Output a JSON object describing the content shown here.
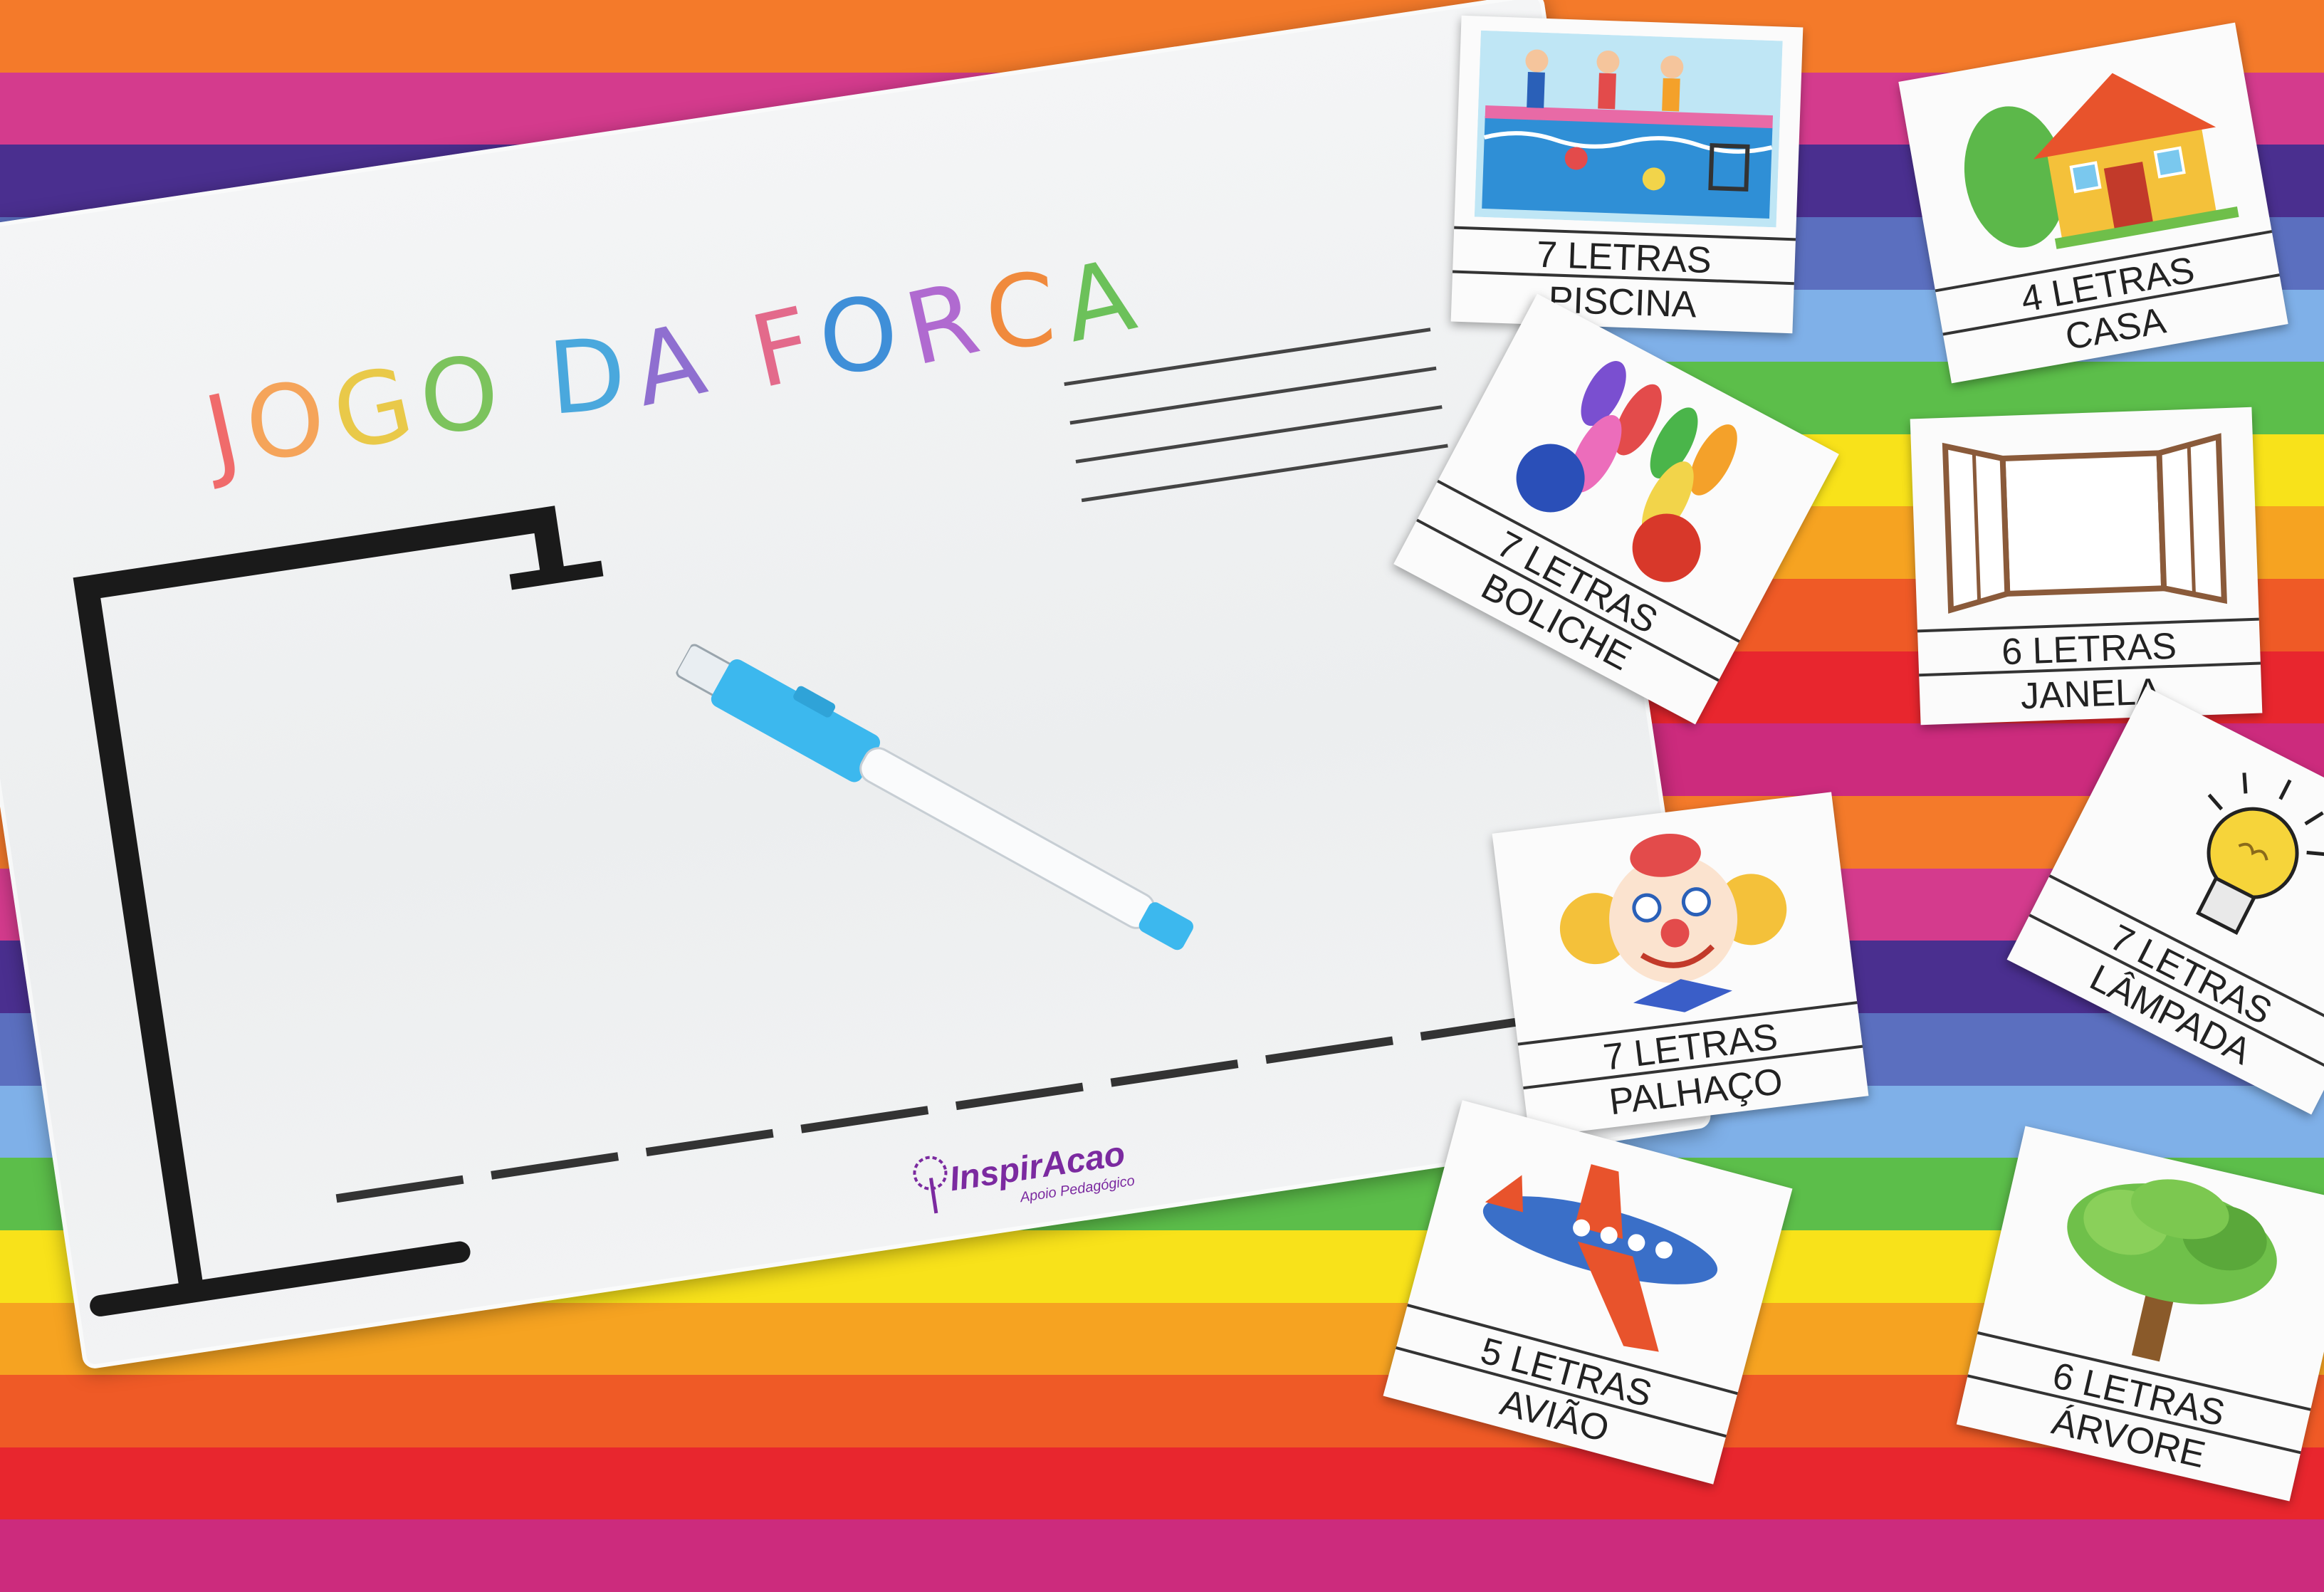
{
  "board": {
    "title_letters": [
      {
        "ch": "J",
        "color": "#f06b6b"
      },
      {
        "ch": "O",
        "color": "#f5a45a"
      },
      {
        "ch": "G",
        "color": "#e9c949"
      },
      {
        "ch": "O",
        "color": "#7cc35d"
      },
      {
        "ch": " ",
        "color": "#000000"
      },
      {
        "ch": "D",
        "color": "#4aa8dd"
      },
      {
        "ch": "A",
        "color": "#8f6fd0"
      },
      {
        "ch": " ",
        "color": "#000000"
      },
      {
        "ch": "F",
        "color": "#e36a8b"
      },
      {
        "ch": "O",
        "color": "#3f8fd8"
      },
      {
        "ch": "R",
        "color": "#b06ad0"
      },
      {
        "ch": "C",
        "color": "#f08a3d"
      },
      {
        "ch": "A",
        "color": "#6cc15a"
      }
    ],
    "logo_text": "InspirAcao",
    "logo_subtitle": "Apoio Pedagógico"
  },
  "cards": [
    {
      "count": "7 LETRAS",
      "word": "PISCINA",
      "icon": "swimming-pool-icon"
    },
    {
      "count": "4 LETRAS",
      "word": "CASA",
      "icon": "house-icon"
    },
    {
      "count": "7 LETRAS",
      "word": "BOLICHE",
      "icon": "bowling-pins-icon"
    },
    {
      "count": "6 LETRAS",
      "word": "JANELA",
      "icon": "window-icon"
    },
    {
      "count": "7 LETRAS",
      "word": "PALHAÇO",
      "icon": "clown-icon"
    },
    {
      "count": "7 LETRAS",
      "word": "LÂMPADA",
      "icon": "light-bulb-icon"
    },
    {
      "count": "5 LETRAS",
      "word": "AVIÃO",
      "icon": "airplane-icon"
    },
    {
      "count": "6 LETRAS",
      "word": "ÁRVORE",
      "icon": "tree-icon"
    }
  ],
  "colors": {
    "stripes": [
      "#f47a2a",
      "#d43b8d",
      "#4a2f8f",
      "#5b6fbf",
      "#7fb0e8",
      "#5cbe4a",
      "#f8e21a",
      "#f6a321",
      "#ef5a26",
      "#e8262e",
      "#cc2b7d"
    ],
    "marker_accent": "#3cb8ee",
    "hangman_ink": "#1a1a1a"
  }
}
